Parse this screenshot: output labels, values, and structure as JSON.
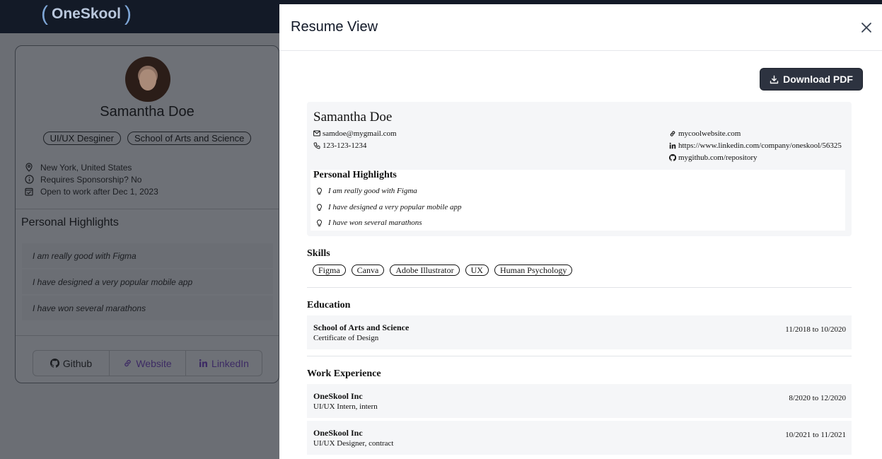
{
  "app": {
    "logo_text": "OneSkool"
  },
  "profile": {
    "name": "Samantha Doe",
    "tags": [
      "UI/UX Desginer",
      "School of Arts and Science"
    ],
    "location": "New York, United States",
    "sponsorship": "Requires Sponsorship? No",
    "availability": "Open to work after Dec 1, 2023",
    "highlights_title": "Personal Highlights",
    "highlights": [
      "I am really good with Figma",
      "I have designed a very popular mobile app",
      "I have won several marathons"
    ],
    "links": {
      "github": "Github",
      "website": "Website",
      "linkedin": "LinkedIn"
    }
  },
  "modal": {
    "title": "Resume View",
    "download_label": "Download PDF"
  },
  "resume": {
    "name": "Samantha Doe",
    "email": "samdoe@mygmail.com",
    "phone": "123-123-1234",
    "website": "mycoolwebsite.com",
    "linkedin": "https://www.linkedin.com/company/oneskool/56325",
    "github": "mygithub.com/repository",
    "highlights_title": "Personal Highlights",
    "highlights": [
      "I am really good with Figma",
      "I have designed a very popular mobile app",
      "I have won several marathons"
    ],
    "skills_title": "Skills",
    "skills": [
      "Figma",
      "Canva",
      "Adobe Illustrator",
      "UX",
      "Human Psychology"
    ],
    "education_title": "Education",
    "education": [
      {
        "org": "School of Arts and Science",
        "detail": "Certificate of Design",
        "dates": "11/2018 to 10/2020"
      }
    ],
    "work_title": "Work Experience",
    "work": [
      {
        "org": "OneSkool Inc",
        "detail": "UI/UX Intern, intern",
        "dates": "8/2020 to 12/2020"
      },
      {
        "org": "OneSkool Inc",
        "detail": "UI/UX Designer, contract",
        "dates": "10/2021 to 11/2021"
      }
    ]
  },
  "colors": {
    "overlay": "#6b6e74",
    "topbar": "#131a27",
    "button_dark": "#2d3340",
    "accent_purple": "#3d2b64"
  }
}
